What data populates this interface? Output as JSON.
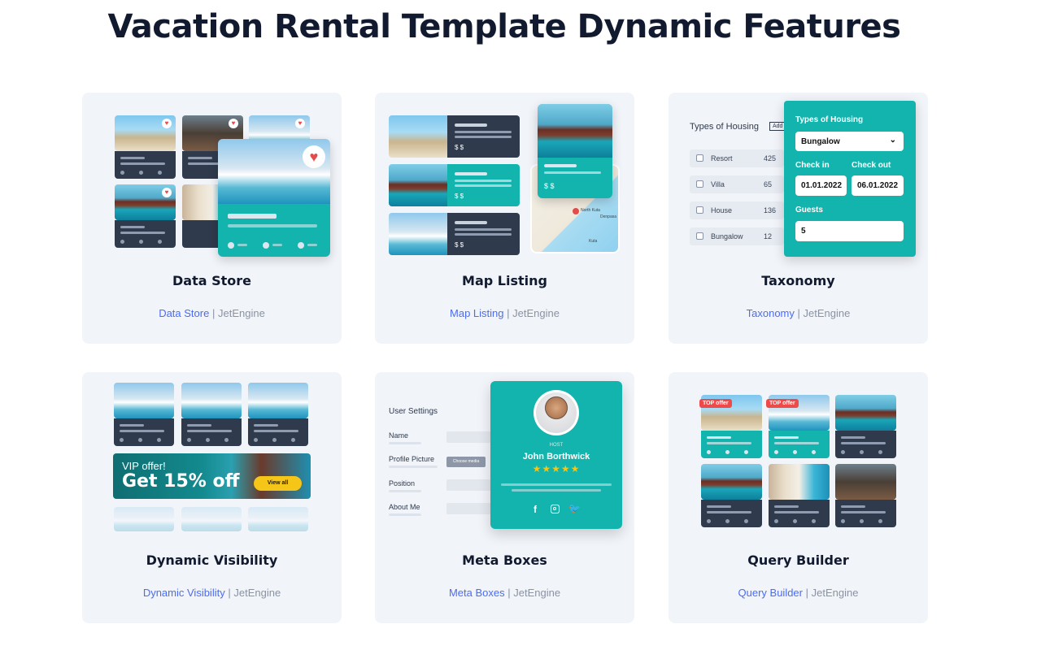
{
  "page": {
    "title": "Vacation Rental Template Dynamic Features"
  },
  "link_suffix": "JetEngine",
  "separator": "|",
  "cards": [
    {
      "title": "Data Store",
      "link": "Data Store"
    },
    {
      "title": "Map Listing",
      "link": "Map Listing"
    },
    {
      "title": "Taxonomy",
      "link": "Taxonomy"
    },
    {
      "title": "Dynamic Visibility",
      "link": "Dynamic Visibility"
    },
    {
      "title": "Meta Boxes",
      "link": "Meta Boxes"
    },
    {
      "title": "Query Builder",
      "link": "Query Builder"
    }
  ],
  "map_listing": {
    "price": "$ $",
    "map_labels": {
      "town1": "North Kuta",
      "town2": "Denpasa",
      "town3": "Kuta"
    }
  },
  "taxonomy": {
    "heading": "Types of Housing",
    "add_button": "Add",
    "rows": [
      {
        "label": "Resort",
        "count": "425"
      },
      {
        "label": "Villa",
        "count": "65"
      },
      {
        "label": "House",
        "count": "136"
      },
      {
        "label": "Bungalow",
        "count": "12"
      }
    ],
    "panel": {
      "title": "Types of Housing",
      "select_value": "Bungalow",
      "checkin_label": "Check in",
      "checkout_label": "Check out",
      "checkin_value": "01.01.2022",
      "checkout_value": "06.01.2022",
      "guests_label": "Guests",
      "guests_value": "5"
    }
  },
  "visibility": {
    "banner_line1": "VIP offer!",
    "banner_line2": "Get 15% off",
    "banner_button": "View all"
  },
  "meta_boxes": {
    "heading": "User Settings",
    "fields": [
      "Name",
      "Profile Picture",
      "Position",
      "About Me"
    ],
    "choose_media": "Choose media",
    "host_role": "HOST",
    "host_name": "John Borthwick",
    "rating": "★★★★★"
  },
  "query_builder": {
    "offer_tag": "TOP offer"
  },
  "colors": {
    "teal": "#13b4ad",
    "navy": "#2f3a4d",
    "link": "#4a6cf7",
    "red": "#ef4a4a",
    "gold": "#f5c518"
  }
}
